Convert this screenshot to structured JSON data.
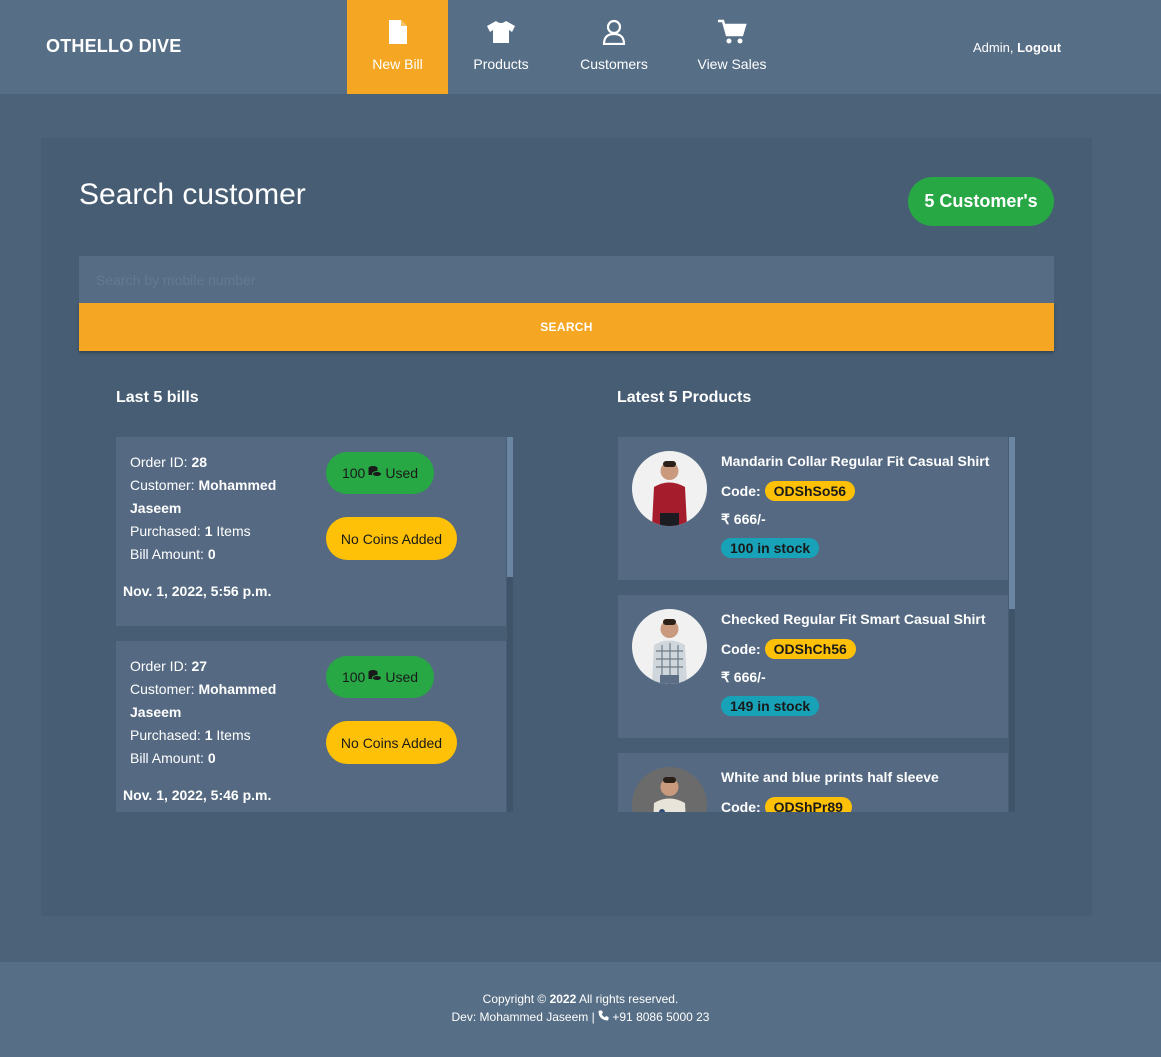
{
  "nav": {
    "brand": "OTHELLO DIVE",
    "items": [
      {
        "label": "New Bill",
        "icon": "file-icon",
        "active": true
      },
      {
        "label": "Products",
        "icon": "tshirt-icon",
        "active": false
      },
      {
        "label": "Customers",
        "icon": "user-icon",
        "active": false
      },
      {
        "label": "View Sales",
        "icon": "cart-icon",
        "active": false
      }
    ],
    "user_prefix": "Admin,",
    "logout_label": "Logout"
  },
  "search": {
    "title": "Search customer",
    "customers_count": "5 Customer's",
    "placeholder": "Search by mobile number",
    "button_label": "SEARCH"
  },
  "bills": {
    "title": "Last 5 bills",
    "labels": {
      "order_id": "Order ID:",
      "customer": "Customer:",
      "purchased": "Purchased:",
      "bill_amount": "Bill Amount:"
    },
    "items": [
      {
        "order_id": "28",
        "customer": "Mohammed Jaseem",
        "purchased": "1",
        "items_suffix": "Items",
        "bill_amount": "0",
        "coins_used_value": "100",
        "coins_used_suffix": "Used",
        "coins_added": "No Coins Added",
        "date": "Nov. 1, 2022, 5:56 p.m."
      },
      {
        "order_id": "27",
        "customer": "Mohammed Jaseem",
        "purchased": "1",
        "items_suffix": "Items",
        "bill_amount": "0",
        "coins_used_value": "100",
        "coins_used_suffix": "Used",
        "coins_added": "No Coins Added",
        "date": "Nov. 1, 2022, 5:46 p.m."
      }
    ]
  },
  "products": {
    "title": "Latest 5 Products",
    "code_label": "Code:",
    "items": [
      {
        "name": "Mandarin Collar Regular Fit Casual Shirt",
        "code": "ODShSo56",
        "price": "₹ 666/-",
        "stock": "100 in stock",
        "shirt_color": "#a51d2d"
      },
      {
        "name": "Checked Regular Fit Smart Casual Shirt",
        "code": "ODShCh56",
        "price": "₹ 666/-",
        "stock": "149 in stock",
        "shirt_color": "#cfd6dc"
      },
      {
        "name": "White and blue prints half sleeve",
        "code": "ODShPr89",
        "price": "",
        "stock": "",
        "shirt_color": "#e8e4da"
      }
    ]
  },
  "footer": {
    "copyright_prefix": "Copyright ©",
    "year": "2022",
    "rights": "All rights reserved.",
    "dev": "Dev: Mohammed Jaseem |",
    "phone": "+91 8086 5000 23"
  },
  "colors": {
    "accent": "#f5a623",
    "success": "#28a745",
    "warning": "#ffc107",
    "info": "#17a2b8"
  }
}
